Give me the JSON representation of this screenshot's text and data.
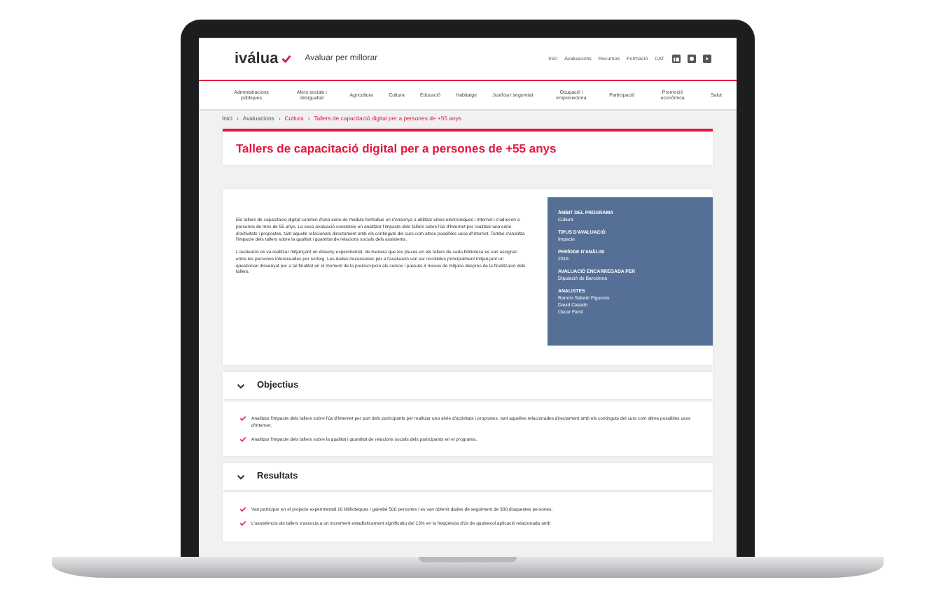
{
  "header": {
    "logo": "iválua",
    "tagline": "Avaluar per millorar",
    "links": [
      "Inici",
      "Avaluacions",
      "Recursos",
      "Formació"
    ],
    "language": "CAT"
  },
  "nav": {
    "items": [
      {
        "label": "Administracions públiques"
      },
      {
        "label": "Afers socials i desigualtat"
      },
      {
        "label": "Agricultura"
      },
      {
        "label": "Cultura"
      },
      {
        "label": "Educació"
      },
      {
        "label": "Habitatge"
      },
      {
        "label": "Justícia i seguretat"
      },
      {
        "label": "Ocupació i emprenedoria"
      },
      {
        "label": "Participació"
      },
      {
        "label": "Promoció econòmica"
      },
      {
        "label": "Salut"
      }
    ]
  },
  "breadcrumb": [
    {
      "label": "Inici",
      "current": false
    },
    {
      "separator": "›",
      "label": "Avaluacions",
      "current": false
    },
    {
      "separator": "›",
      "label": "Cultura",
      "current": true
    },
    {
      "separator": "›",
      "label": "Tallers de capacitació digital per a persones de +55 anys",
      "current": true
    }
  ],
  "title": "Tallers de capacitació digital per a persones de +55 anys",
  "description": [
    "Els tallers de capacitació digital consten d'una sèrie de mòduls formatius on s'ensenya a utilitzar eines electròniques i Internet i s'adrecen a persones de més de 55 anys. La seva avaluació consisteix en analitzar l'impacte dels tallers sobre l'ús d'Internet per realitzar una sèrie d'activitats i propostes, tant aquells relacionats directament amb els continguts del curs com altres possibles usos d'Internet. També s'analitza l'impacte dels tallers sobre la qualitat i quantitat de relacions socials dels assistents.",
    "L'avaluació es va realitzar mitjançant un disseny experimental, de manera que les places en els tallers de cada biblioteca es van assignar entre les persones interessades per sorteig. Les dades necessàries per a l'avaluació van ser recollides principalment mitjançant un qüestionari dissenyat per a tal finalitat en el moment de la preinscripció als cursos i passats 4 mesos de mitjana després de la finalització dels tallers."
  ],
  "facts": [
    {
      "label": "ÀMBIT DEL PROGRAMA",
      "values": [
        "Cultura"
      ]
    },
    {
      "label": "TIPUS D'AVALUACIÓ",
      "values": [
        "Impacte"
      ]
    },
    {
      "label": "PERÍODE D'ANÀLISI",
      "values": [
        "2016"
      ]
    },
    {
      "label": "AVALUACIÓ ENCARREGADA PER",
      "values": [
        "Diputació de Barcelona"
      ]
    },
    {
      "label": "ANALISTES",
      "values": [
        "Ramon Sabaté Figueres",
        "David Casado",
        "Oscar Farré"
      ]
    }
  ],
  "sections": [
    {
      "title": "Objectius",
      "expanded": true,
      "items": [
        "Analitzar l'impacte dels tallers sobre l'ús d'Internet per part dels participants per realitzar una sèrie d'activitats i propostes, tant aquelles relacionades directament amb els continguts del curs com altres possibles usos d'Internet.",
        "Analitzar l'impacte dels tallers sobre la qualitat i quantitat de relacions socials dels participants en el programa."
      ]
    },
    {
      "title": "Resultats",
      "expanded": true,
      "items": [
        "Van participar en el projecte experimental 16 biblioteques i gairebé 500 persones i es van obtenir dades de seguiment de 380 d'aquestes persones.",
        "L'assistència als tallers s'associa a un increment estadísticament significatiu del 13% en la freqüència d'ús de qualsevol aplicació relacionada amb"
      ]
    }
  ]
}
